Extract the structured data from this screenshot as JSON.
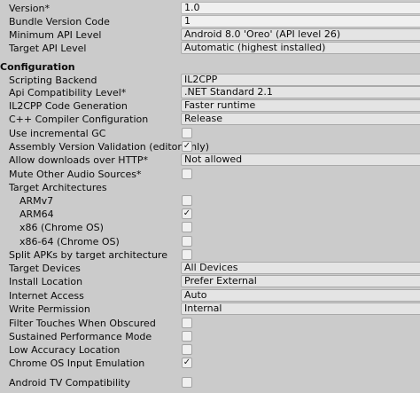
{
  "identification": {
    "version_label": "Version*",
    "version_value": "1.0",
    "bundle_version_code_label": "Bundle Version Code",
    "bundle_version_code_value": "1",
    "min_api_label": "Minimum API Level",
    "min_api_value": "Android 8.0 'Oreo' (API level 26)",
    "target_api_label": "Target API Level",
    "target_api_value": "Automatic (highest installed)"
  },
  "configuration": {
    "section_title": "Configuration",
    "scripting_backend_label": "Scripting Backend",
    "scripting_backend_value": "IL2CPP",
    "api_compat_label": "Api Compatibility Level*",
    "api_compat_value": ".NET Standard 2.1",
    "il2cpp_codegen_label": "IL2CPP Code Generation",
    "il2cpp_codegen_value": "Faster runtime",
    "cpp_compiler_label": "C++ Compiler Configuration",
    "cpp_compiler_value": "Release",
    "incremental_gc_label": "Use incremental GC",
    "incremental_gc_checked": false,
    "assembly_validation_label": "Assembly Version Validation (editor only)",
    "assembly_validation_checked": true,
    "allow_http_label": "Allow downloads over HTTP*",
    "allow_http_value": "Not allowed",
    "mute_audio_label": "Mute Other Audio Sources*",
    "mute_audio_checked": false,
    "target_arch_label": "Target Architectures",
    "armv7_label": "ARMv7",
    "armv7_checked": false,
    "arm64_label": "ARM64",
    "arm64_checked": true,
    "x86_label": "x86 (Chrome OS)",
    "x86_checked": false,
    "x86_64_label": "x86-64 (Chrome OS)",
    "x86_64_checked": false,
    "split_apks_label": "Split APKs by target architecture",
    "split_apks_checked": false,
    "target_devices_label": "Target Devices",
    "target_devices_value": "All Devices",
    "install_location_label": "Install Location",
    "install_location_value": "Prefer External",
    "internet_access_label": "Internet Access",
    "internet_access_value": "Auto",
    "write_permission_label": "Write Permission",
    "write_permission_value": "Internal",
    "filter_touches_label": "Filter Touches When Obscured",
    "filter_touches_checked": false,
    "sustained_perf_label": "Sustained Performance Mode",
    "sustained_perf_checked": false,
    "low_accuracy_label": "Low Accuracy Location",
    "low_accuracy_checked": false,
    "chromeos_input_label": "Chrome OS Input Emulation",
    "chromeos_input_checked": true,
    "android_tv_label": "Android TV Compatibility",
    "android_tv_checked": false
  },
  "icons": {
    "checkmark": "checkmark-icon"
  }
}
